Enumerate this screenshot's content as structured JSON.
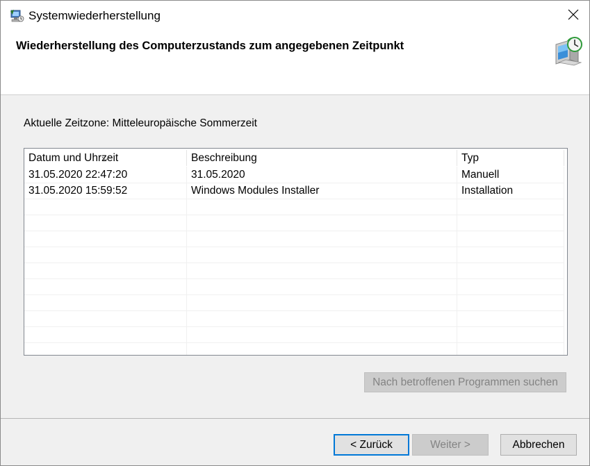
{
  "window": {
    "title": "Systemwiederherstellung",
    "icon": "system-restore-icon",
    "close_icon": "close-icon"
  },
  "header": {
    "title": "Wiederherstellung des Computerzustands zum angegebenen Zeitpunkt",
    "icon": "system-restore-clock-icon"
  },
  "timezone_label": "Aktuelle Zeitzone: Mitteleuropäische Sommerzeit",
  "table": {
    "columns": [
      "Datum und Uhrzeit",
      "Beschreibung",
      "Typ"
    ],
    "sort_column": "Datum und Uhrzeit",
    "sort_direction": "descending",
    "rows": [
      {
        "date": "31.05.2020 22:47:20",
        "description": "31.05.2020",
        "type": "Manuell"
      },
      {
        "date": "31.05.2020 15:59:52",
        "description": "Windows Modules Installer",
        "type": "Installation"
      }
    ]
  },
  "buttons": {
    "scan_affected": "Nach betroffenen Programmen suchen",
    "back": "< Zurück",
    "next": "Weiter >",
    "cancel": "Abbrechen"
  },
  "colors": {
    "focus_border": "#0078d7",
    "disabled_text": "#838383",
    "dialog_bg": "#f0f0f0"
  }
}
